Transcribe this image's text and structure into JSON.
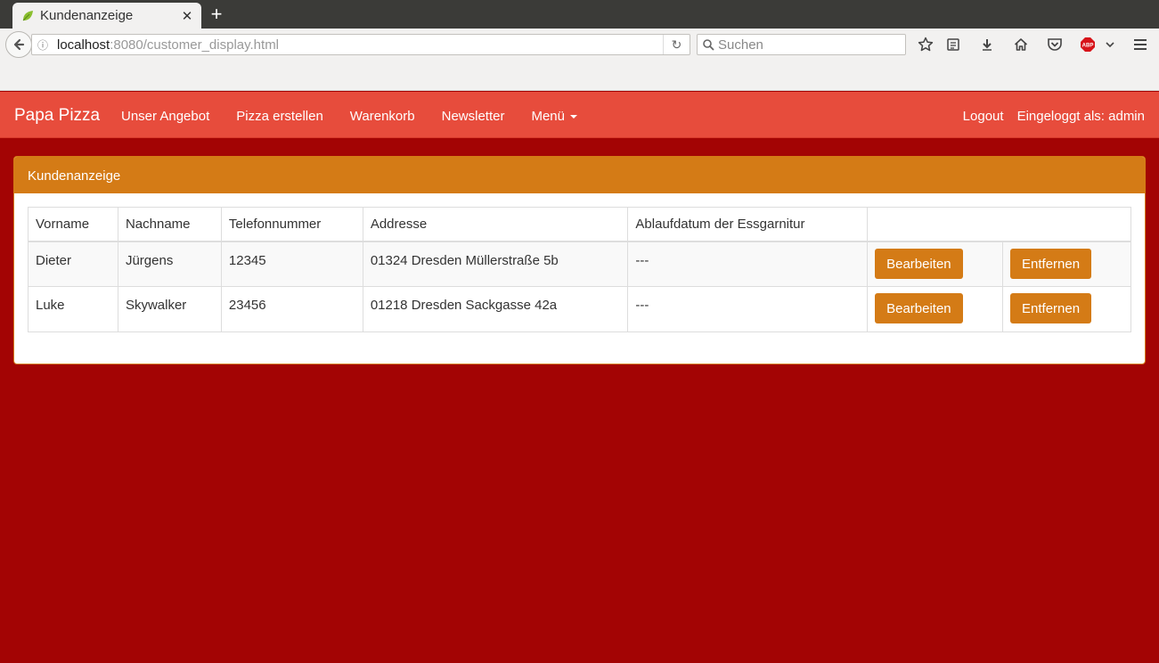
{
  "browser": {
    "tab_title": "Kundenanzeige",
    "url_host": "localhost",
    "url_rest": ":8080/customer_display.html",
    "search_placeholder": "Suchen"
  },
  "app": {
    "brand": "Papa Pizza",
    "nav": [
      {
        "label": "Unser Angebot"
      },
      {
        "label": "Pizza erstellen"
      },
      {
        "label": "Warenkorb"
      },
      {
        "label": "Newsletter"
      },
      {
        "label": "Menü"
      }
    ],
    "logout": "Logout",
    "logged_in": "Eingeloggt als: admin"
  },
  "panel": {
    "title": "Kundenanzeige"
  },
  "table": {
    "headers": [
      "Vorname",
      "Nachname",
      "Telefonnummer",
      "Addresse",
      "Ablaufdatum der Essgarnitur",
      ""
    ],
    "rows": [
      {
        "first": "Dieter",
        "last": "Jürgens",
        "phone": "12345",
        "address": "01324 Dresden Müllerstraße 5b",
        "expiry": "---",
        "edit": "Bearbeiten",
        "remove": "Entfernen"
      },
      {
        "first": "Luke",
        "last": "Skywalker",
        "phone": "23456",
        "address": "01218 Dresden Sackgasse 42a",
        "expiry": "---",
        "edit": "Bearbeiten",
        "remove": "Entfernen"
      }
    ]
  },
  "colors": {
    "page_bg": "#a30404",
    "navbar": "#e74c3c",
    "accent": "#d47b16"
  }
}
